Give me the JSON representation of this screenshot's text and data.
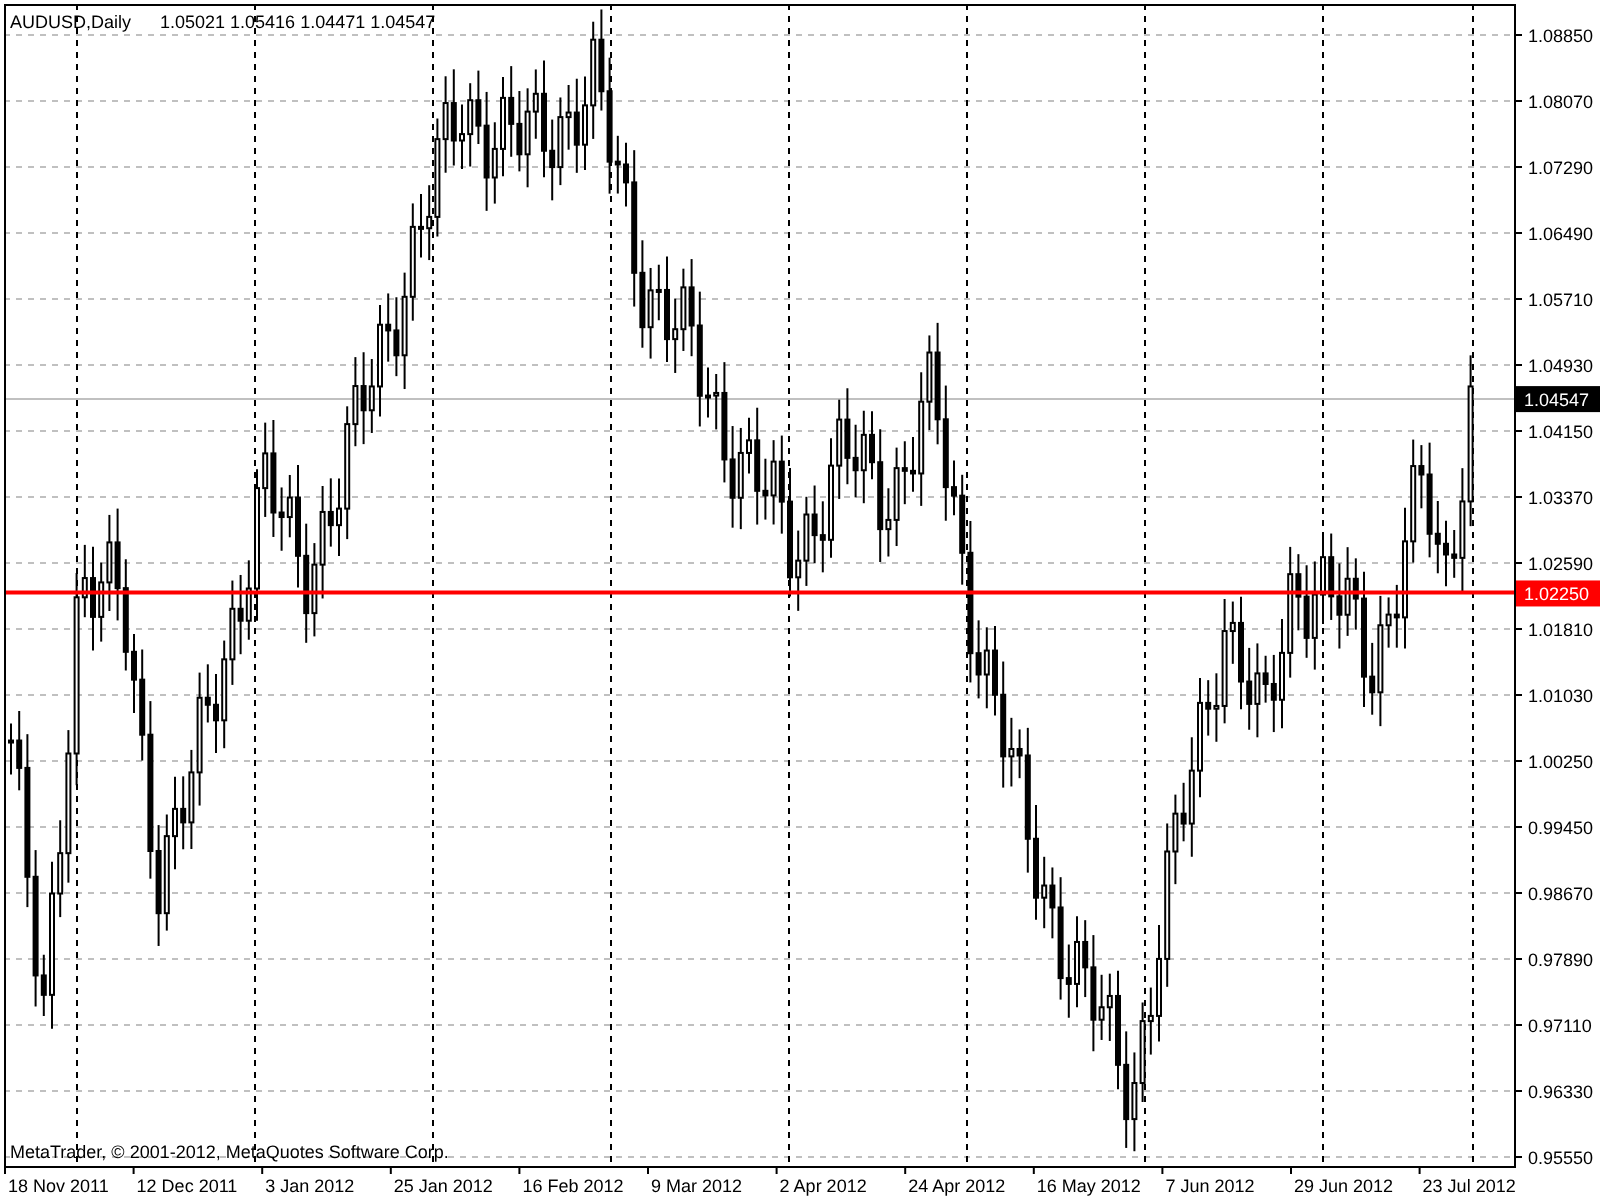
{
  "chart": {
    "symbol": "AUDUSD,Daily",
    "quote": "1.05021 1.05416 1.04471 1.04547",
    "price_labels": [
      "1.08850",
      "1.08070",
      "1.07290",
      "1.06490",
      "1.05710",
      "1.04930",
      "1.04150",
      "1.03370",
      "1.02590",
      "1.01810",
      "1.01030",
      "1.00250",
      "0.99450",
      "0.98670",
      "0.97890",
      "0.97110",
      "0.96330",
      "0.95550"
    ],
    "date_labels": [
      "18 Nov 2011",
      "12 Dec 2011",
      "3 Jan 2012",
      "25 Jan 2012",
      "16 Feb 2012",
      "9 Mar 2012",
      "2 Apr 2012",
      "24 Apr 2012",
      "16 May 2012",
      "7 Jun 2012",
      "29 Jun 2012",
      "23 Jul 2012"
    ],
    "current_price": "1.04547",
    "level_line": {
      "label": "1.02250",
      "color": "#ff0000"
    },
    "copyright": "MetaTrader, © 2001-2012, MetaQuotes Software Corp."
  }
}
